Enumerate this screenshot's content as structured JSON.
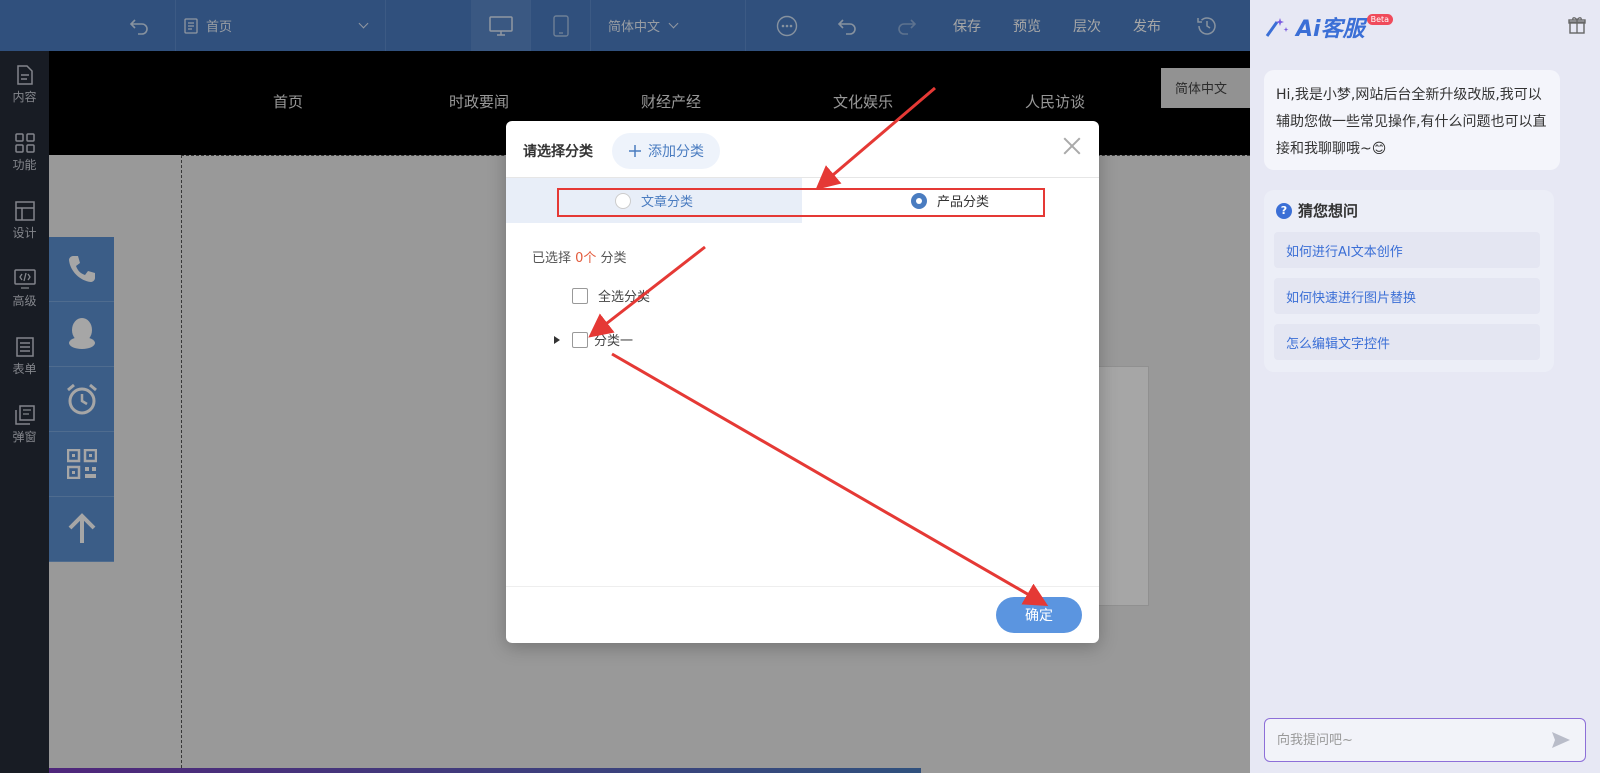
{
  "topbar": {
    "page_select": "首页",
    "language_select": "简体中文",
    "save": "保存",
    "preview": "预览",
    "layers": "层次",
    "publish": "发布"
  },
  "sidebar": {
    "items": [
      {
        "label": "内容",
        "icon": "document-icon"
      },
      {
        "label": "功能",
        "icon": "grid-icon"
      },
      {
        "label": "设计",
        "icon": "layout-icon"
      },
      {
        "label": "高级",
        "icon": "code-icon"
      },
      {
        "label": "表单",
        "icon": "list-icon"
      },
      {
        "label": "弹窗",
        "icon": "popup-icon"
      }
    ]
  },
  "site": {
    "nav": [
      "首页",
      "时政要闻",
      "财经产经",
      "文化娱乐",
      "人民访谈"
    ],
    "language_tag": "简体中文"
  },
  "dialog": {
    "title": "请选择分类",
    "add_category": "添加分类",
    "tab_article": "文章分类",
    "tab_product": "产品分类",
    "selected_prefix": "已选择 ",
    "selected_count": "0个",
    "selected_suffix": " 分类",
    "select_all": "全选分类",
    "category_one": "分类一",
    "confirm": "确定"
  },
  "ai_panel": {
    "logo_text": "Ai客服",
    "beta": "Beta",
    "greeting": "Hi,我是小梦,网站后台全新升级改版,我可以辅助您做一些常见操作,有什么问题也可以直接和我聊聊哦~😊",
    "guess_title": "猜您想问",
    "guess_items": [
      "如何进行AI文本创作",
      "如何快速进行图片替换",
      "怎么编辑文字控件"
    ],
    "input_placeholder": "向我提问吧~"
  },
  "colors": {
    "topbar": "#4a7cc0",
    "sidebar": "#252b38",
    "accent": "#5b95e0",
    "annotation": "#e53935"
  }
}
